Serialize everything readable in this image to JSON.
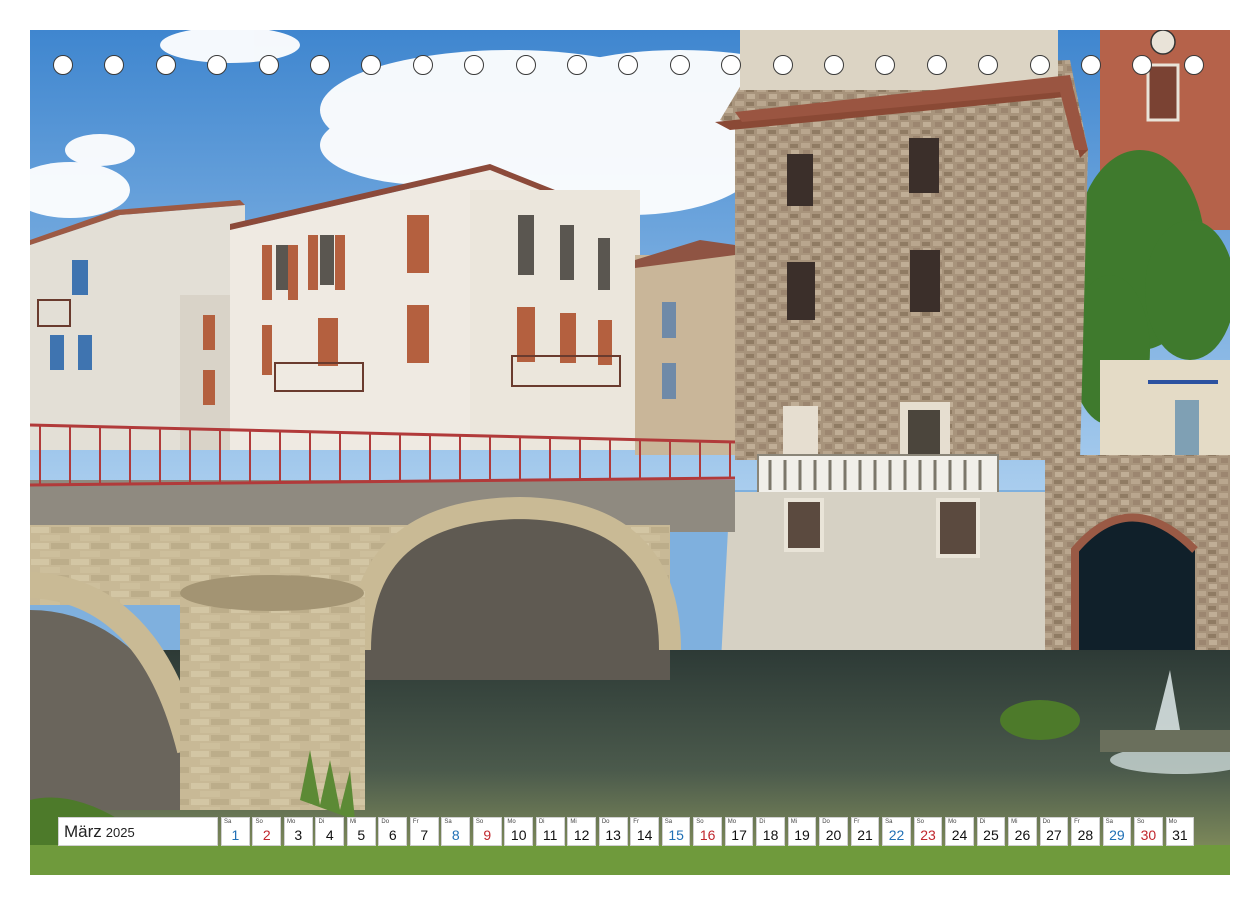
{
  "calendar": {
    "month": "März",
    "year": "2025",
    "days": [
      {
        "dow": "Sa",
        "num": "1",
        "type": "sat"
      },
      {
        "dow": "So",
        "num": "2",
        "type": "sun"
      },
      {
        "dow": "Mo",
        "num": "3",
        "type": "wk"
      },
      {
        "dow": "Di",
        "num": "4",
        "type": "wk"
      },
      {
        "dow": "Mi",
        "num": "5",
        "type": "wk"
      },
      {
        "dow": "Do",
        "num": "6",
        "type": "wk"
      },
      {
        "dow": "Fr",
        "num": "7",
        "type": "wk"
      },
      {
        "dow": "Sa",
        "num": "8",
        "type": "sat"
      },
      {
        "dow": "So",
        "num": "9",
        "type": "sun"
      },
      {
        "dow": "Mo",
        "num": "10",
        "type": "wk"
      },
      {
        "dow": "Di",
        "num": "11",
        "type": "wk"
      },
      {
        "dow": "Mi",
        "num": "12",
        "type": "wk"
      },
      {
        "dow": "Do",
        "num": "13",
        "type": "wk"
      },
      {
        "dow": "Fr",
        "num": "14",
        "type": "wk"
      },
      {
        "dow": "Sa",
        "num": "15",
        "type": "sat"
      },
      {
        "dow": "So",
        "num": "16",
        "type": "sun"
      },
      {
        "dow": "Mo",
        "num": "17",
        "type": "wk"
      },
      {
        "dow": "Di",
        "num": "18",
        "type": "wk"
      },
      {
        "dow": "Mi",
        "num": "19",
        "type": "wk"
      },
      {
        "dow": "Do",
        "num": "20",
        "type": "wk"
      },
      {
        "dow": "Fr",
        "num": "21",
        "type": "wk"
      },
      {
        "dow": "Sa",
        "num": "22",
        "type": "sat"
      },
      {
        "dow": "So",
        "num": "23",
        "type": "sun"
      },
      {
        "dow": "Mo",
        "num": "24",
        "type": "wk"
      },
      {
        "dow": "Di",
        "num": "25",
        "type": "wk"
      },
      {
        "dow": "Mi",
        "num": "26",
        "type": "wk"
      },
      {
        "dow": "Do",
        "num": "27",
        "type": "wk"
      },
      {
        "dow": "Fr",
        "num": "28",
        "type": "wk"
      },
      {
        "dow": "Sa",
        "num": "29",
        "type": "sat"
      },
      {
        "dow": "So",
        "num": "30",
        "type": "sun"
      },
      {
        "dow": "Mo",
        "num": "31",
        "type": "wk"
      }
    ]
  },
  "colors": {
    "saturday": "#1f6fb5",
    "sunday": "#c0262d"
  },
  "binding_holes": 23
}
